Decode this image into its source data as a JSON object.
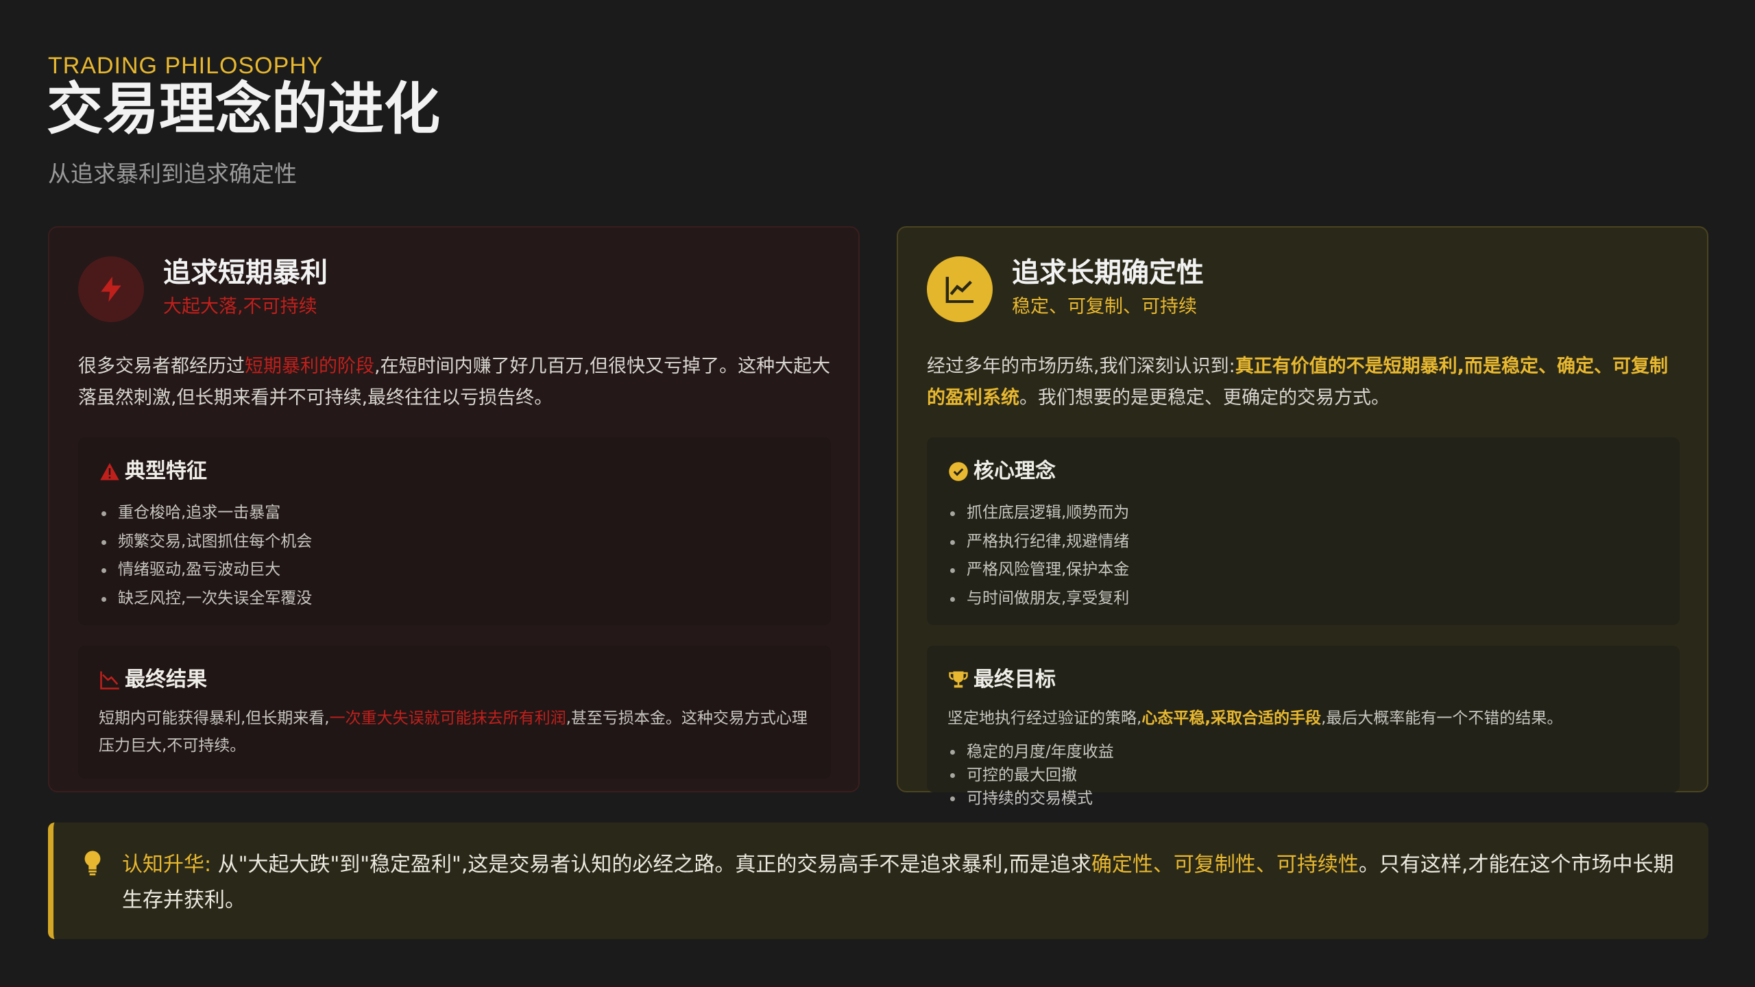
{
  "header": {
    "eyebrow": "TRADING PHILOSOPHY",
    "title": "交易理念的进化",
    "subtitle": "从追求暴利到追求确定性"
  },
  "left_panel": {
    "title": "追求短期暴利",
    "tagline": "大起大落,不可持续",
    "icon": "lightning-icon",
    "intro_before": "很多交易者都经历过",
    "intro_highlight": "短期暴利的阶段",
    "intro_after": ",在短时间内赚了好几百万,但很快又亏掉了。这种大起大落虽然刺激,但长期来看并不可持续,最终往往以亏损告终。",
    "features": {
      "title": "典型特征",
      "icon": "warning-icon",
      "items": [
        "重仓梭哈,追求一击暴富",
        "频繁交易,试图抓住每个机会",
        "情绪驱动,盈亏波动巨大",
        "缺乏风控,一次失误全军覆没"
      ]
    },
    "result": {
      "title": "最终结果",
      "icon": "chart-down-icon",
      "text_before": "短期内可能获得暴利,但长期来看,",
      "text_highlight": "一次重大失误就可能抹去所有利润",
      "text_after": ",甚至亏损本金。这种交易方式心理压力巨大,不可持续。"
    }
  },
  "right_panel": {
    "title": "追求长期确定性",
    "tagline": "稳定、可复制、可持续",
    "icon": "chart-line-icon",
    "intro_before": "经过多年的市场历练,我们深刻认识到:",
    "intro_highlight": "真正有价值的不是短期暴利,而是稳定、确定、可复制的盈利系统",
    "intro_after": "。我们想要的是更稳定、更确定的交易方式。",
    "core": {
      "title": "核心理念",
      "icon": "check-circle-icon",
      "items": [
        "抓住底层逻辑,顺势而为",
        "严格执行纪律,规避情绪",
        "严格风险管理,保护本金",
        "与时间做朋友,享受复利"
      ]
    },
    "goal": {
      "title": "最终目标",
      "icon": "trophy-icon",
      "text_before": "坚定地执行经过验证的策略,",
      "text_highlight": "心态平稳,采取合适的手段",
      "text_after": ",最后大概率能有一个不错的结果。",
      "items": [
        "稳定的月度/年度收益",
        "可控的最大回撤",
        "可持续的交易模式"
      ]
    }
  },
  "insight": {
    "icon": "lightbulb-icon",
    "lead": "认知升华:",
    "text_before": " 从\"大起大跌\"到\"稳定盈利\",这是交易者认知的必经之路。真正的交易高手不是追求暴利,而是追求",
    "text_highlight": "确定性、可复制性、可持续性",
    "text_after": "。只有这样,才能在这个市场中长期生存并获利。"
  },
  "colors": {
    "background": "#1b1b1b",
    "accent_gold": "#e8b830",
    "accent_red": "#c0201c"
  }
}
